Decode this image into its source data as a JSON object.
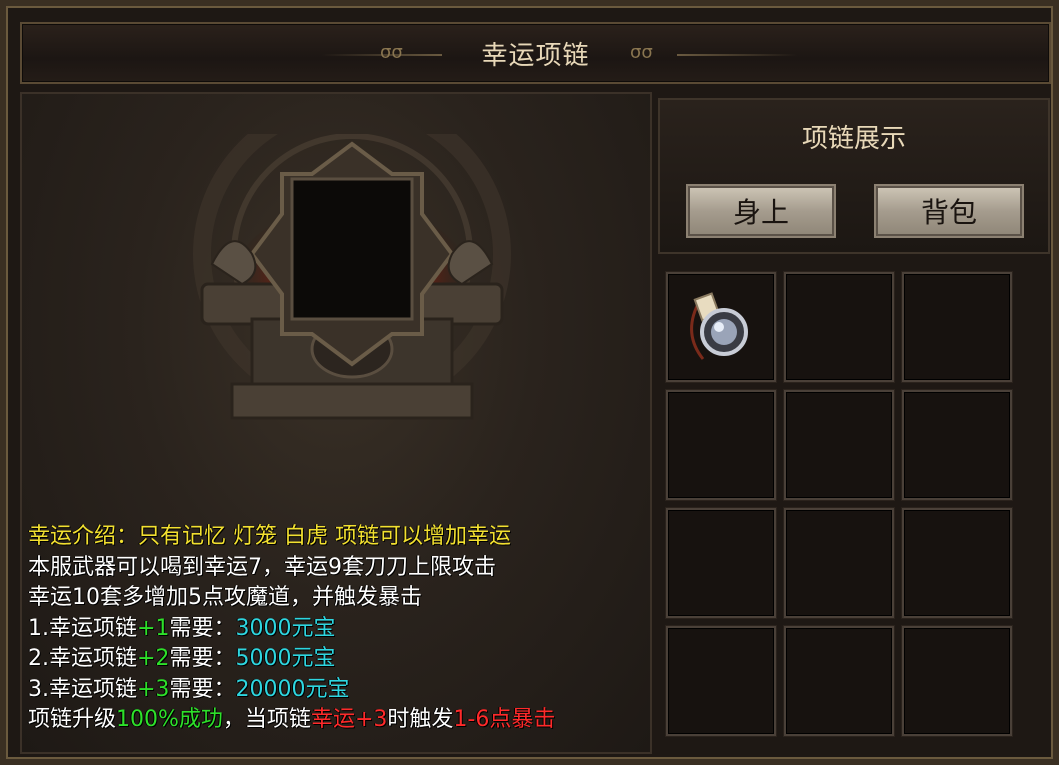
{
  "window": {
    "title": "幸运项链"
  },
  "showcase": {
    "title": "项链展示",
    "tabs": [
      {
        "label": "身上"
      },
      {
        "label": "背包"
      }
    ]
  },
  "inventory": {
    "slots": [
      {
        "item": "necklace-icon"
      },
      {
        "item": null
      },
      {
        "item": null
      },
      {
        "item": null
      },
      {
        "item": null
      },
      {
        "item": null
      },
      {
        "item": null
      },
      {
        "item": null
      },
      {
        "item": null
      },
      {
        "item": null
      },
      {
        "item": null
      },
      {
        "item": null
      }
    ]
  },
  "info": {
    "line1": "幸运介绍：只有记忆 灯笼 白虎 项链可以增加幸运",
    "line2": "本服武器可以喝到幸运7，幸运9套刀刀上限攻击",
    "line3": "幸运10套多增加5点攻魔道，并触发暴击",
    "upgrade1": {
      "prefix": "1.幸运项链",
      "level": "+1",
      "need": "需要：",
      "cost": "3000元宝"
    },
    "upgrade2": {
      "prefix": "2.幸运项链",
      "level": "+2",
      "need": "需要：",
      "cost": "5000元宝"
    },
    "upgrade3": {
      "prefix": "3.幸运项链",
      "level": "+3",
      "need": "需要：",
      "cost": "20000元宝"
    },
    "line7": {
      "a": "项链升级",
      "b": "100%成功",
      "c": "，当项链",
      "d": "幸运+3",
      "e": "时触发",
      "f": "1-6点暴击"
    }
  },
  "colors": {
    "yellow": "#f2e030",
    "green": "#2ee02a",
    "cyan": "#2ed6e0",
    "red": "#ff2a2a"
  }
}
